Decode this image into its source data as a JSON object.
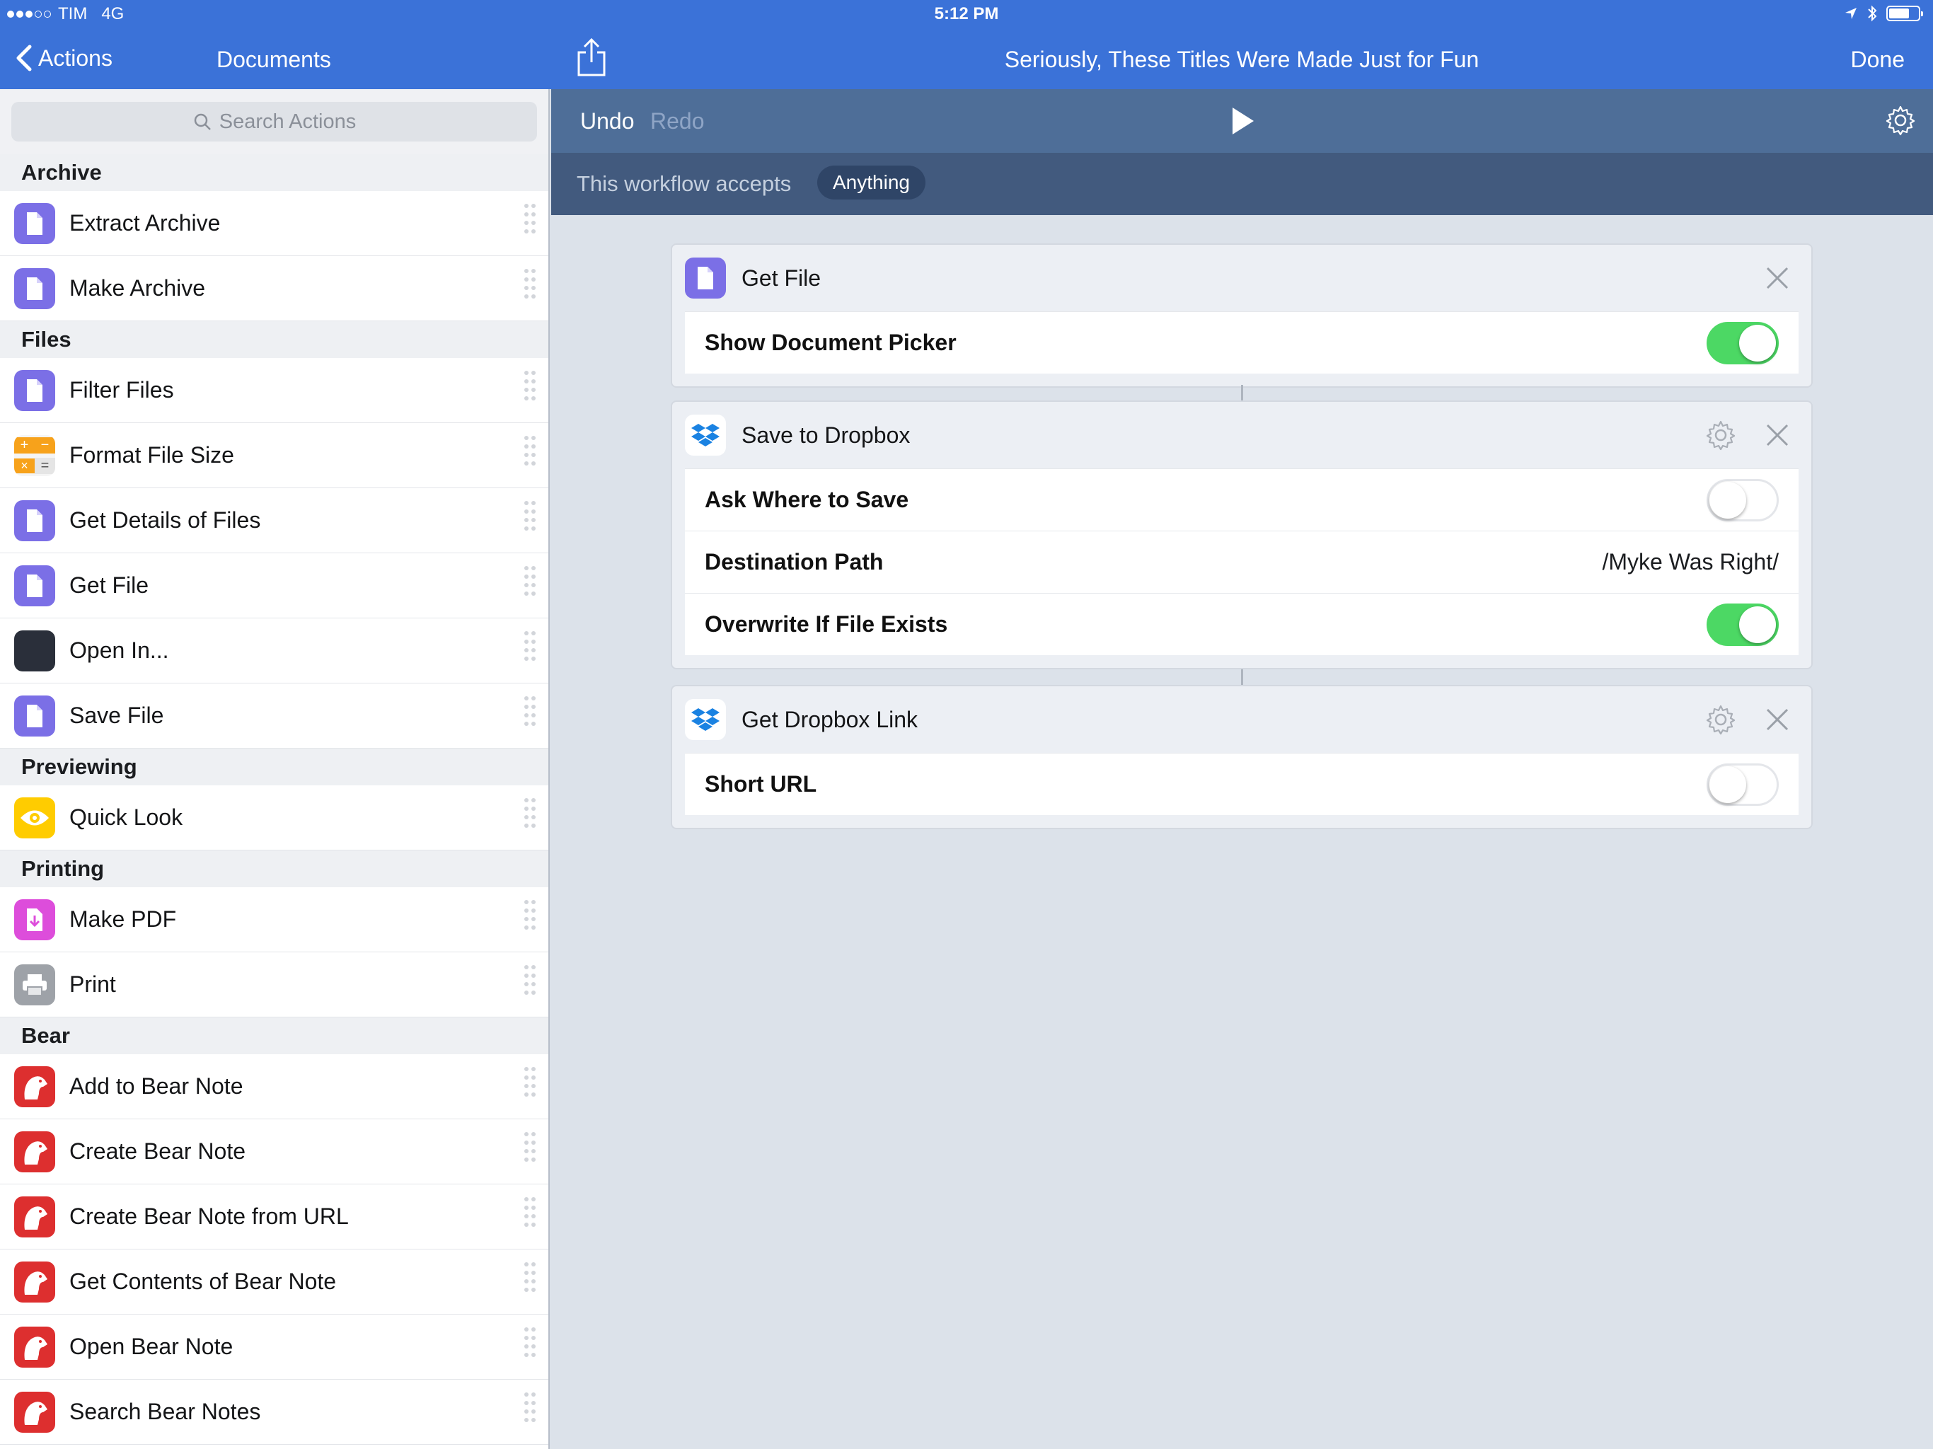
{
  "status": {
    "carrier": "TIM",
    "network": "4G",
    "time": "5:12 PM"
  },
  "nav": {
    "back_label": "Actions",
    "sidebar_title": "Documents",
    "workflow_title": "Seriously, These Titles Were Made Just for Fun",
    "done_label": "Done"
  },
  "search": {
    "placeholder": "Search Actions"
  },
  "sections": {
    "archive": {
      "title": "Archive",
      "items": [
        "Extract Archive",
        "Make Archive"
      ]
    },
    "files": {
      "title": "Files",
      "items": [
        "Filter Files",
        "Format File Size",
        "Get Details of Files",
        "Get File",
        "Open In...",
        "Save File"
      ]
    },
    "previewing": {
      "title": "Previewing",
      "items": [
        "Quick Look"
      ]
    },
    "printing": {
      "title": "Printing",
      "items": [
        "Make PDF",
        "Print"
      ]
    },
    "bear": {
      "title": "Bear",
      "items": [
        "Add to Bear Note",
        "Create Bear Note",
        "Create Bear Note from URL",
        "Get Contents of Bear Note",
        "Open Bear Note",
        "Search Bear Notes"
      ]
    }
  },
  "toolbar": {
    "undo": "Undo",
    "redo": "Redo"
  },
  "accepts": {
    "label": "This workflow accepts",
    "value": "Anything"
  },
  "actions": [
    {
      "title": "Get File",
      "params": [
        {
          "label": "Show Document Picker",
          "toggle": true
        }
      ]
    },
    {
      "title": "Save to Dropbox",
      "params": [
        {
          "label": "Ask Where to Save",
          "toggle": false
        },
        {
          "label": "Destination Path",
          "value": "/Myke Was Right/"
        },
        {
          "label": "Overwrite If File Exists",
          "toggle": true
        }
      ]
    },
    {
      "title": "Get Dropbox Link",
      "params": [
        {
          "label": "Short URL",
          "toggle": false
        }
      ]
    }
  ],
  "colors": {
    "accent": "#3b72d8",
    "toolbar": "#4e6e98",
    "accepts_bar": "#425a7e",
    "toggle_on": "#4cd864",
    "documents_icon": "#7b6fe6",
    "bear_icon": "#dd2f2f"
  }
}
